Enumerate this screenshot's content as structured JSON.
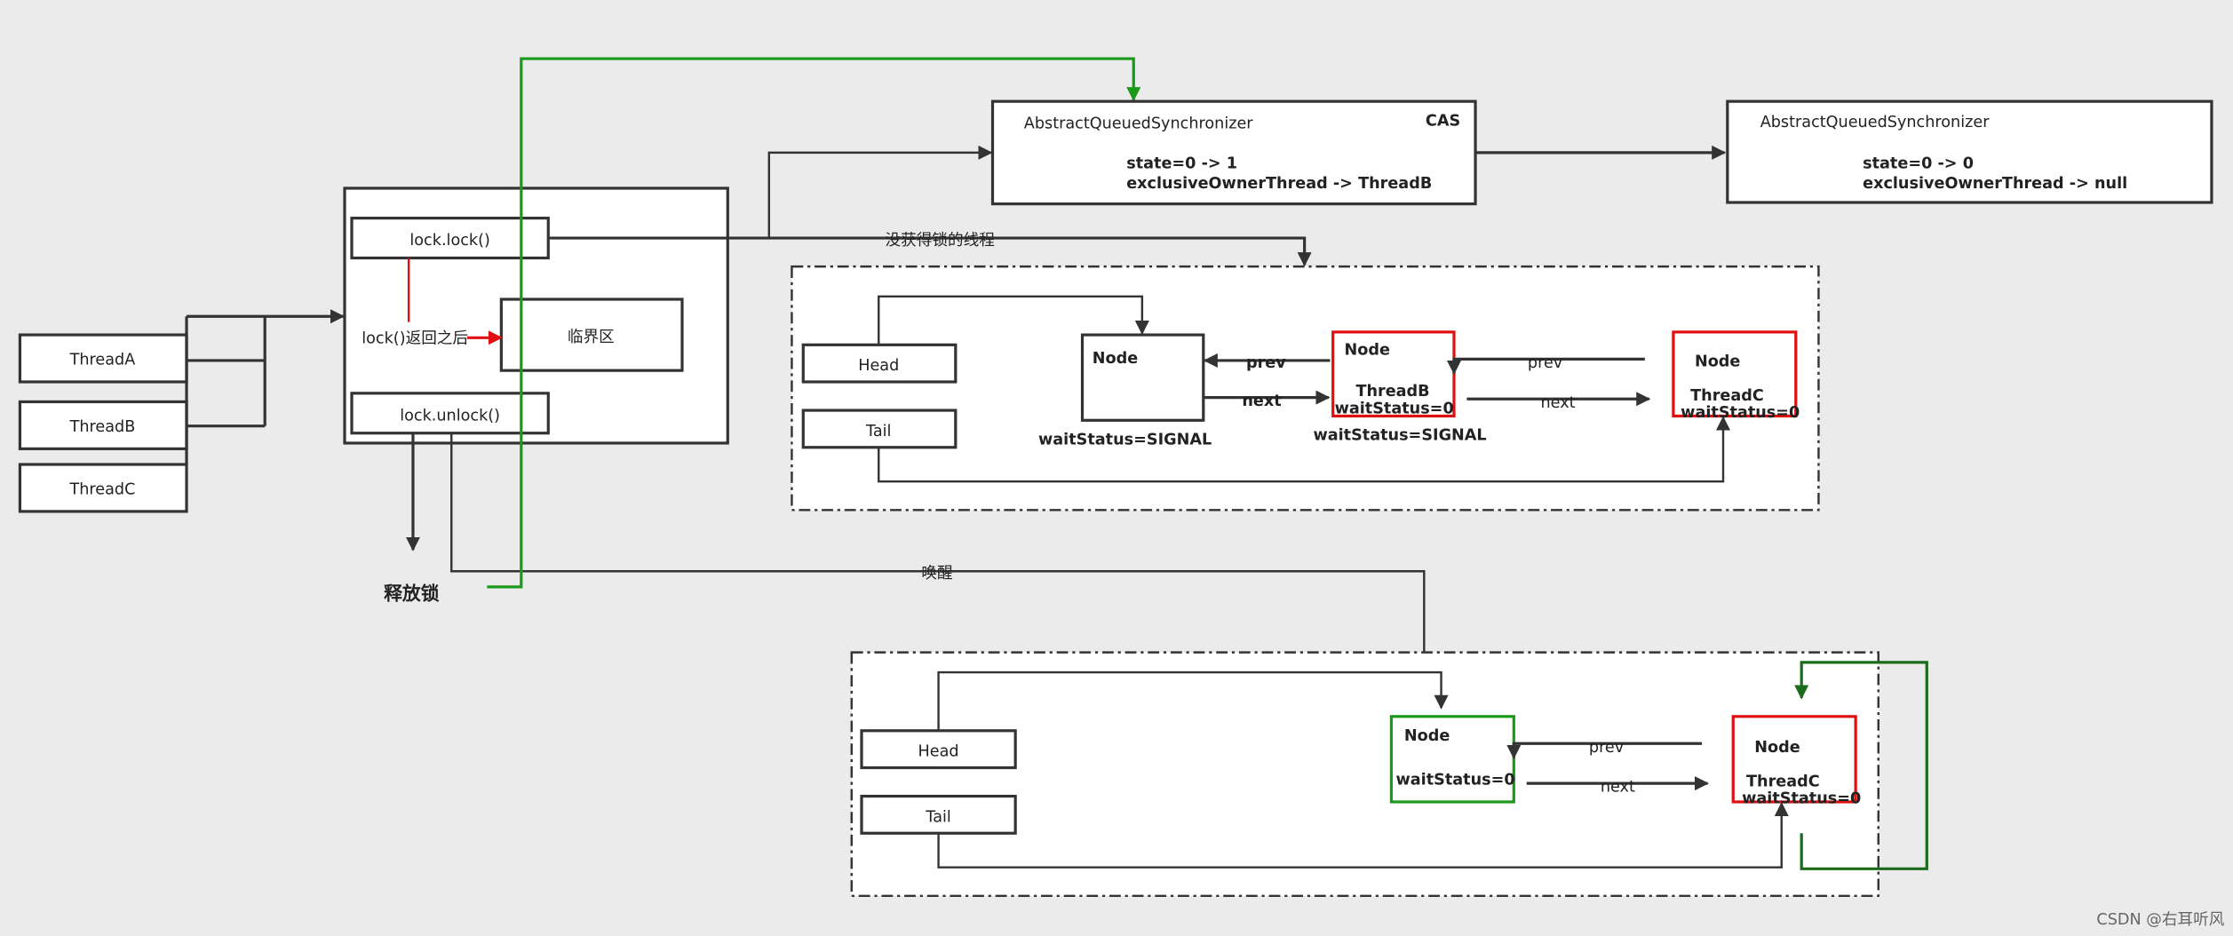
{
  "colors": {
    "background": "#ebebeb",
    "red": "#e01010",
    "green": "#1a9a1a",
    "dark_green": "#1a6b1a",
    "line": "#333333"
  },
  "threads": [
    "ThreadA",
    "ThreadB",
    "ThreadC"
  ],
  "lock_box": {
    "lock": "lock.lock()",
    "unlock": "lock.unlock()",
    "after_lock": "lock()返回之后",
    "critical": "临界区"
  },
  "release_label": "释放锁",
  "wakeup_label": "唤醒",
  "not_acquired_label": "没获得锁的线程",
  "aqs1": {
    "title": "AbstractQueuedSynchronizer",
    "cas": "CAS",
    "state": "state=0  -> 1",
    "owner": "exclusiveOwnerThread -> ThreadB"
  },
  "aqs2": {
    "title": "AbstractQueuedSynchronizer",
    "state": "state=0  -> 0",
    "owner": "exclusiveOwnerThread ->  null"
  },
  "queue1": {
    "head": "Head",
    "tail": "Tail",
    "node1": {
      "title": "Node",
      "status": "waitStatus=SIGNAL"
    },
    "node2": {
      "title": "Node",
      "thread": "ThreadB",
      "inner_status": "waitStatus=0",
      "status": "waitStatus=SIGNAL"
    },
    "node3": {
      "title": "Node",
      "thread": "ThreadC",
      "inner_status": "waitStatus=0"
    },
    "prev": "prev",
    "next": "next"
  },
  "queue2": {
    "head": "Head",
    "tail": "Tail",
    "node1": {
      "title": "Node",
      "inner_status": "waitStatus=0"
    },
    "node2": {
      "title": "Node",
      "thread": "ThreadC",
      "inner_status": "waitStatus=0"
    },
    "prev": "prev",
    "next": "next"
  },
  "watermark": "CSDN @右耳听风"
}
